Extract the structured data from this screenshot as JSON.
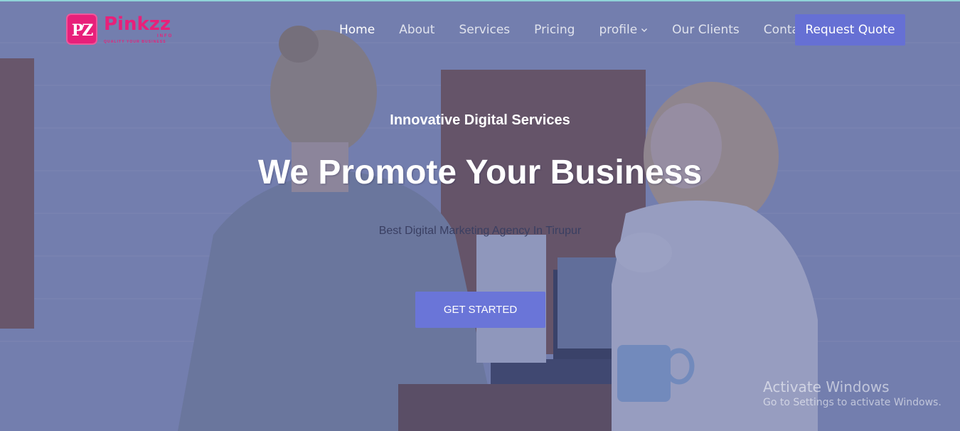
{
  "brand": {
    "logo_mark": "PZ",
    "name": "Pinkzz",
    "sub": "INFO",
    "tagline": "QUALITY YOUR BUSINESS"
  },
  "nav": {
    "items": [
      "Home",
      "About",
      "Services",
      "Pricing",
      "profile",
      "Our Clients",
      "Contact"
    ],
    "active": "Home",
    "cta": "Request Quote"
  },
  "hero": {
    "eyebrow": "Innovative Digital Services",
    "headline": "We Promote Your Business",
    "subline": "Best Digital Marketing Agency In Tirupur",
    "button": "GET STARTED"
  },
  "watermark": {
    "title": "Activate Windows",
    "subtitle": "Go to Settings to activate Windows."
  },
  "colors": {
    "accent": "#6670d4",
    "brand": "#e8207a",
    "overlay": "#465291"
  }
}
